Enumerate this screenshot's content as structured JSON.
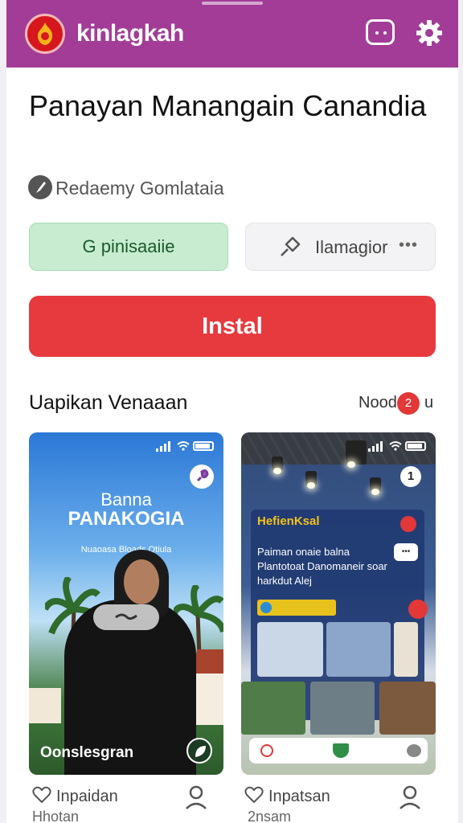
{
  "header": {
    "app_name": "kinlagkah",
    "bg_color": "#a23c97",
    "logo_icon": "flame-emblem-logo",
    "chat_icon": "chat-bubble-icon",
    "settings_icon": "gear-icon"
  },
  "app": {
    "title": "Panayan Manangain Canandia",
    "developer": "Redaemy Gomlataia",
    "developer_icon": "compass-icon"
  },
  "chips": {
    "category_label": "G pinisaaiie",
    "secondary_label": "Ilamagior",
    "secondary_more": "•••"
  },
  "install": {
    "label": "Instal",
    "color": "#e63a3f"
  },
  "screenshots_section": {
    "title": "Uapikan Venaaan",
    "link_label": "Nood",
    "badge": "2",
    "link_after": "u"
  },
  "screenshot1": {
    "title_top": "Banna",
    "title_main": "PANAKOGIA",
    "subtitle": "Nuaoasa Bloads Otiula",
    "caption": "Oonslesgran"
  },
  "screenshot2": {
    "badge": "1",
    "panel_title": "HefienKsal",
    "panel_text": "Paiman onaie balna Plantotoat Danomaneir soar harkdut Alej",
    "bubble": "•••"
  },
  "cards": [
    {
      "label": "Inpaidan",
      "sub": "Hhotan"
    },
    {
      "label": "Inpatsan",
      "sub": "2nsam"
    }
  ]
}
